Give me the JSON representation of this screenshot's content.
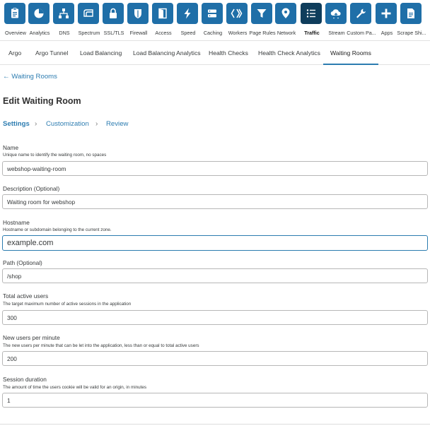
{
  "topnav": {
    "apps": [
      {
        "label": "Overview",
        "icon": "clipboard-icon"
      },
      {
        "label": "Analytics",
        "icon": "pie-chart-icon"
      },
      {
        "label": "DNS",
        "icon": "network-tree-icon"
      },
      {
        "label": "Spectrum",
        "icon": "spectrum-icon"
      },
      {
        "label": "SSL/TLS",
        "icon": "lock-icon"
      },
      {
        "label": "Firewall",
        "icon": "shield-icon"
      },
      {
        "label": "Access",
        "icon": "door-icon"
      },
      {
        "label": "Speed",
        "icon": "lightning-icon"
      },
      {
        "label": "Caching",
        "icon": "server-icon"
      },
      {
        "label": "Workers",
        "icon": "workers-icon"
      },
      {
        "label": "Page Rules",
        "icon": "filter-icon"
      },
      {
        "label": "Network",
        "icon": "location-pin-icon"
      },
      {
        "label": "Traffic",
        "icon": "list-icon"
      },
      {
        "label": "Stream",
        "icon": "cloud-upload-icon"
      },
      {
        "label": "Custom Pa...",
        "icon": "wrench-icon"
      },
      {
        "label": "Apps",
        "icon": "plus-icon"
      },
      {
        "label": "Scrape Shi...",
        "icon": "document-icon"
      }
    ],
    "active_index": 12,
    "tile_color": "#1f6fa8",
    "active_tile_color": "#0f3d5c"
  },
  "subnav": {
    "tabs": [
      "Argo",
      "Argo Tunnel",
      "Load Balancing",
      "Load Balancing Analytics",
      "Health Checks",
      "Health Check Analytics",
      "Waiting Rooms"
    ],
    "active_index": 6
  },
  "back_link": "← Waiting Rooms",
  "page_title": "Edit Waiting Room",
  "steps": {
    "items": [
      "Settings",
      "Customization",
      "Review"
    ],
    "current": 0
  },
  "form": {
    "name": {
      "label": "Name",
      "help": "Unique name to identify the waiting room, no spaces",
      "value": "webshop-waiting-room"
    },
    "description": {
      "label": "Description (Optional)",
      "value": "Waiting room for webshop"
    },
    "hostname": {
      "label": "Hostname",
      "help": "Hostname or subdomain belonging to the current zone.",
      "value": "example.com"
    },
    "path": {
      "label": "Path (Optional)",
      "value": "/shop"
    },
    "total_active_users": {
      "label": "Total active users",
      "help": "The target maximum number of active sessions in the application",
      "value": "300"
    },
    "new_users_per_minute": {
      "label": "New users per minute",
      "help": "The new users per minute that can be let into the application, less than or equal to total active users",
      "value": "200"
    },
    "session_duration": {
      "label": "Session duration",
      "help": "The amount of time the users cookie will be valid for an origin, in minutes",
      "value": "1"
    }
  },
  "colors": {
    "link": "#2c7cb0",
    "accent": "#2c7cb0"
  }
}
